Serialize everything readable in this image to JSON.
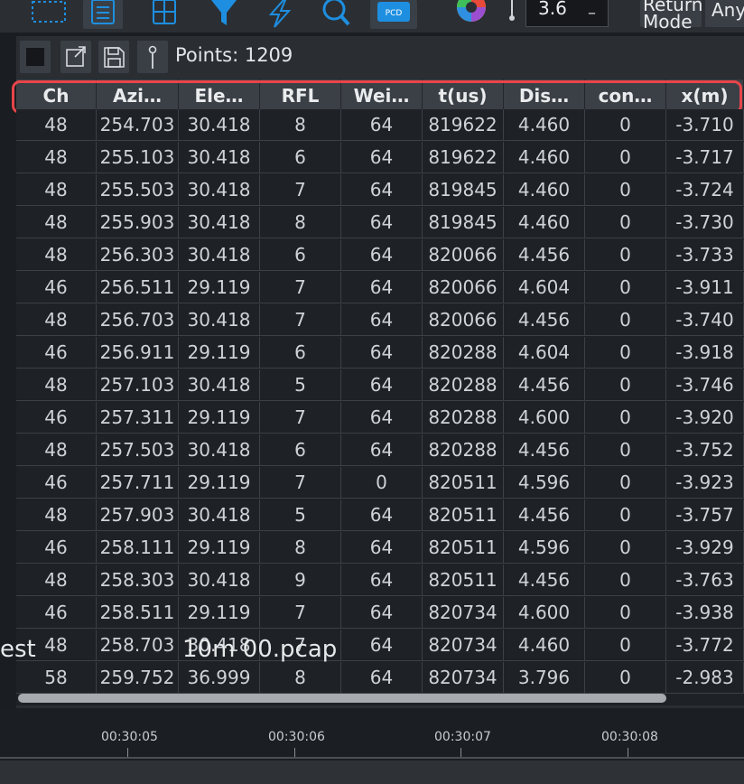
{
  "toolbar": {
    "icons": [
      "select-rect-icon",
      "list-view-icon",
      "grid-view-icon",
      "filter-icon",
      "lightning-icon",
      "search-icon",
      "pcd-icon",
      "color-wheel-icon"
    ],
    "pcd_label": "PCD",
    "point_size_value": "3.6",
    "point_size_minus": "–",
    "return_mode_label": "Return Mode",
    "return_mode_value": "Any"
  },
  "panel": {
    "points_label": "Points: 1209"
  },
  "table": {
    "columns": [
      "Ch",
      "Azi…",
      "Ele…",
      "RFL",
      "Wei…",
      "t(us)",
      "Dis…",
      "con…",
      "x(m)"
    ],
    "rows": [
      [
        "48",
        "254.703",
        "30.418",
        "8",
        "64",
        "819622",
        "4.460",
        "0",
        "-3.710"
      ],
      [
        "48",
        "255.103",
        "30.418",
        "6",
        "64",
        "819622",
        "4.460",
        "0",
        "-3.717"
      ],
      [
        "48",
        "255.503",
        "30.418",
        "7",
        "64",
        "819845",
        "4.460",
        "0",
        "-3.724"
      ],
      [
        "48",
        "255.903",
        "30.418",
        "8",
        "64",
        "819845",
        "4.460",
        "0",
        "-3.730"
      ],
      [
        "48",
        "256.303",
        "30.418",
        "6",
        "64",
        "820066",
        "4.456",
        "0",
        "-3.733"
      ],
      [
        "46",
        "256.511",
        "29.119",
        "7",
        "64",
        "820066",
        "4.604",
        "0",
        "-3.911"
      ],
      [
        "48",
        "256.703",
        "30.418",
        "7",
        "64",
        "820066",
        "4.456",
        "0",
        "-3.740"
      ],
      [
        "46",
        "256.911",
        "29.119",
        "6",
        "64",
        "820288",
        "4.604",
        "0",
        "-3.918"
      ],
      [
        "48",
        "257.103",
        "30.418",
        "5",
        "64",
        "820288",
        "4.456",
        "0",
        "-3.746"
      ],
      [
        "46",
        "257.311",
        "29.119",
        "7",
        "64",
        "820288",
        "4.600",
        "0",
        "-3.920"
      ],
      [
        "48",
        "257.503",
        "30.418",
        "6",
        "64",
        "820288",
        "4.456",
        "0",
        "-3.752"
      ],
      [
        "46",
        "257.711",
        "29.119",
        "7",
        "0",
        "820511",
        "4.596",
        "0",
        "-3.923"
      ],
      [
        "48",
        "257.903",
        "30.418",
        "5",
        "64",
        "820511",
        "4.456",
        "0",
        "-3.757"
      ],
      [
        "46",
        "258.111",
        "29.119",
        "8",
        "64",
        "820511",
        "4.596",
        "0",
        "-3.929"
      ],
      [
        "48",
        "258.303",
        "30.418",
        "9",
        "64",
        "820511",
        "4.456",
        "0",
        "-3.763"
      ],
      [
        "46",
        "258.511",
        "29.119",
        "7",
        "64",
        "820734",
        "4.600",
        "0",
        "-3.938"
      ],
      [
        "48",
        "258.703",
        "30.418",
        "7",
        "64",
        "820734",
        "4.460",
        "0",
        "-3.772"
      ],
      [
        "58",
        "259.752",
        "36.999",
        "8",
        "64",
        "820734",
        "3.796",
        "0",
        "-2.983"
      ]
    ]
  },
  "overlay": {
    "left_text": "est",
    "file_text": "10m 00.pcap"
  },
  "timeline": {
    "ticks": [
      "00:30:05",
      "00:30:06",
      "00:30:07",
      "00:30:08"
    ]
  },
  "colors": {
    "highlight": "#e8454a",
    "accent_blue": "#1e8fe0"
  }
}
